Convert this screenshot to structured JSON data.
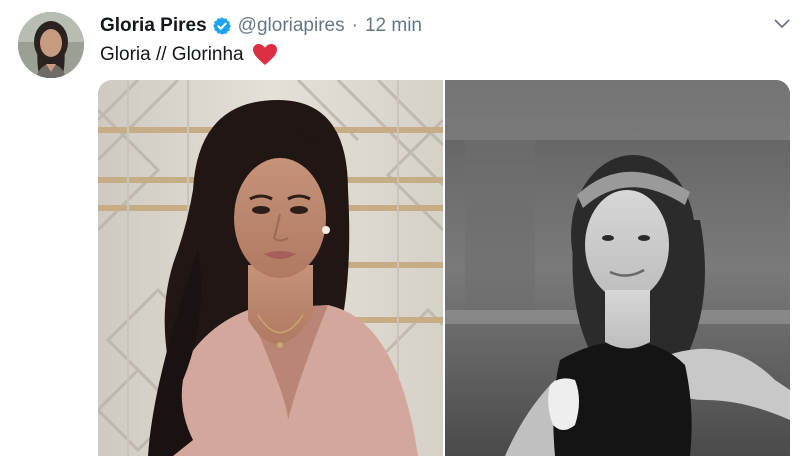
{
  "tweet": {
    "author": {
      "name": "Gloria Pires",
      "handle": "@gloriapires",
      "verified": true,
      "avatar_icon": "profile-photo"
    },
    "separator": "·",
    "timestamp": "12 min",
    "text": "Gloria // Glorinha",
    "emoji": "red-heart",
    "menu_icon": "chevron-down-icon",
    "media": [
      {
        "kind": "photo",
        "description_icon": "color-portrait-photo"
      },
      {
        "kind": "photo",
        "description_icon": "black-and-white-childhood-photo"
      }
    ]
  },
  "colors": {
    "name": "#14171a",
    "secondary": "#657786",
    "verified_badge": "#1da1f2",
    "heart": "#e0245e"
  }
}
